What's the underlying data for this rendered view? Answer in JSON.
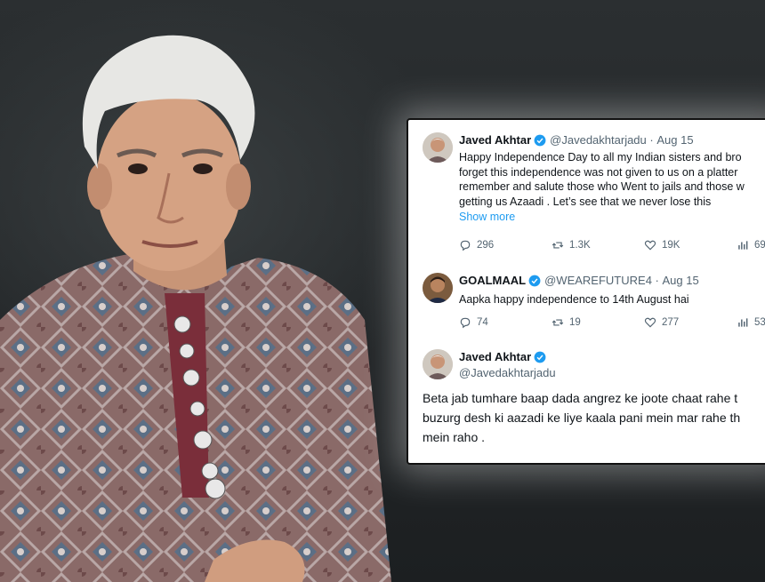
{
  "tweets": [
    {
      "name": "Javed Akhtar",
      "handle": "@Javedakhtarjadu",
      "date": "Aug 15",
      "lines": [
        "Happy Independence Day  to all my Indian sisters and bro",
        "forget this independence was not given to us on a platter",
        "remember and salute those who Went to jails and those w",
        "getting us Azaadi . Let’s see that we never lose this"
      ],
      "show_more": "Show more",
      "stats": {
        "replies": "296",
        "retweets": "1.3K",
        "likes": "19K",
        "views": "69"
      }
    },
    {
      "name": "GOALMAAL",
      "handle": "@WEAREFUTURE4",
      "date": "Aug 15",
      "lines": [
        "Aapka happy independence to 14th August hai"
      ],
      "stats": {
        "replies": "74",
        "retweets": "19",
        "likes": "277",
        "views": "53"
      }
    },
    {
      "name": "Javed Akhtar",
      "handle": "@Javedakhtarjadu",
      "lines": [
        "Beta jab tumhare baap dada angrez ke joote chaat rahe t",
        "buzurg desh ki aazadi ke liye kaala pani mein mar rahe th",
        "mein raho ."
      ]
    }
  ],
  "colors": {
    "verified": "#1d9bf0",
    "link": "#1d9bf0",
    "muted": "#536471"
  },
  "icons": [
    "reply-icon",
    "retweet-icon",
    "like-icon",
    "views-icon",
    "verified-badge-icon"
  ]
}
